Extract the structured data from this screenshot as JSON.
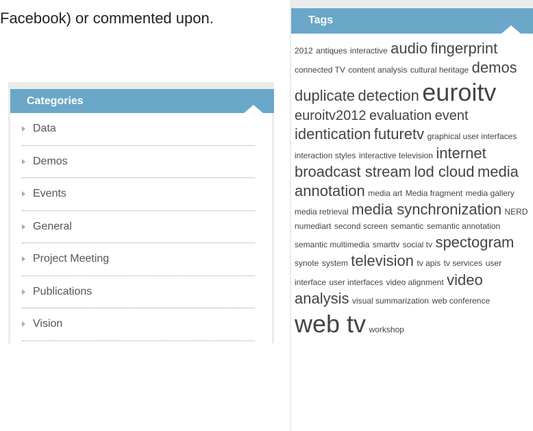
{
  "intro_text": "Facebook) or commented upon.",
  "categories": {
    "title": "Categories",
    "items": [
      {
        "label": "Data"
      },
      {
        "label": "Demos"
      },
      {
        "label": "Events"
      },
      {
        "label": "General"
      },
      {
        "label": "Project Meeting"
      },
      {
        "label": "Publications"
      },
      {
        "label": "Vision"
      }
    ]
  },
  "tags": {
    "title": "Tags",
    "items": [
      {
        "label": "2012",
        "weight": 1
      },
      {
        "label": "antiques",
        "weight": 1
      },
      {
        "label": "interactive",
        "weight": 1
      },
      {
        "label": "audio",
        "weight": 4
      },
      {
        "label": "fingerprint",
        "weight": 4
      },
      {
        "label": "connected TV",
        "weight": 1
      },
      {
        "label": "content analysis",
        "weight": 1
      },
      {
        "label": "cultural heritage",
        "weight": 1
      },
      {
        "label": "demos",
        "weight": 4
      },
      {
        "label": "duplicate",
        "weight": 4
      },
      {
        "label": "detection",
        "weight": 4
      },
      {
        "label": "euroitv",
        "weight": 6
      },
      {
        "label": "euroitv2012",
        "weight": 3
      },
      {
        "label": "evaluation",
        "weight": 3
      },
      {
        "label": "event",
        "weight": 3
      },
      {
        "label": "identication",
        "weight": 4
      },
      {
        "label": "futuretv",
        "weight": 4
      },
      {
        "label": "graphical user interfaces",
        "weight": 1
      },
      {
        "label": "interaction styles",
        "weight": 1
      },
      {
        "label": "interactive television",
        "weight": 1
      },
      {
        "label": "internet broadcast stream",
        "weight": 4
      },
      {
        "label": "lod cloud",
        "weight": 4
      },
      {
        "label": "media annotation",
        "weight": 4
      },
      {
        "label": "media art",
        "weight": 1
      },
      {
        "label": "Media fragment",
        "weight": 1
      },
      {
        "label": "media gallery",
        "weight": 1
      },
      {
        "label": "media retrieval",
        "weight": 1
      },
      {
        "label": "media synchronization",
        "weight": 4
      },
      {
        "label": "NERD",
        "weight": 1
      },
      {
        "label": "numediart",
        "weight": 1
      },
      {
        "label": "second screen",
        "weight": 1
      },
      {
        "label": "semantic",
        "weight": 1
      },
      {
        "label": "semantic annotation",
        "weight": 1
      },
      {
        "label": "semantic multimedia",
        "weight": 1
      },
      {
        "label": "smarttv",
        "weight": 1
      },
      {
        "label": "social tv",
        "weight": 1
      },
      {
        "label": "spectogram",
        "weight": 4
      },
      {
        "label": "synote",
        "weight": 1
      },
      {
        "label": "system",
        "weight": 1
      },
      {
        "label": "television",
        "weight": 4
      },
      {
        "label": "tv apis",
        "weight": 1
      },
      {
        "label": "tv services",
        "weight": 1
      },
      {
        "label": "user interface",
        "weight": 1
      },
      {
        "label": "user interfaces",
        "weight": 1
      },
      {
        "label": "video alignment",
        "weight": 1
      },
      {
        "label": "video analysis",
        "weight": 4
      },
      {
        "label": "visual summarization",
        "weight": 1
      },
      {
        "label": "web conference",
        "weight": 1
      },
      {
        "label": "web tv",
        "weight": 6
      },
      {
        "label": "workshop",
        "weight": 1
      }
    ]
  }
}
